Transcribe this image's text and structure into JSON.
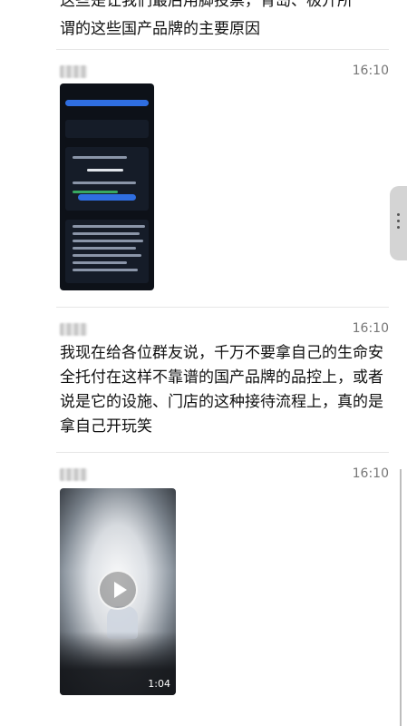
{
  "top_message": {
    "partial_line1": "这些是让我们最后用脚投票，青岛、极开所",
    "line2": "谓的这些国产品牌的主要原因"
  },
  "messages": [
    {
      "time": "16:10",
      "type": "image"
    },
    {
      "time": "16:10",
      "type": "text",
      "text": "我现在给各位群友说，千万不要拿自己的生命安全托付在这样不靠谱的国产品牌的品控上，或者说是它的设施、门店的这种接待流程上，真的是拿自己开玩笑"
    },
    {
      "time": "16:10",
      "type": "video",
      "duration": "1:04"
    }
  ],
  "icons": {
    "play": "play-icon",
    "more": "more-vertical-icon"
  }
}
